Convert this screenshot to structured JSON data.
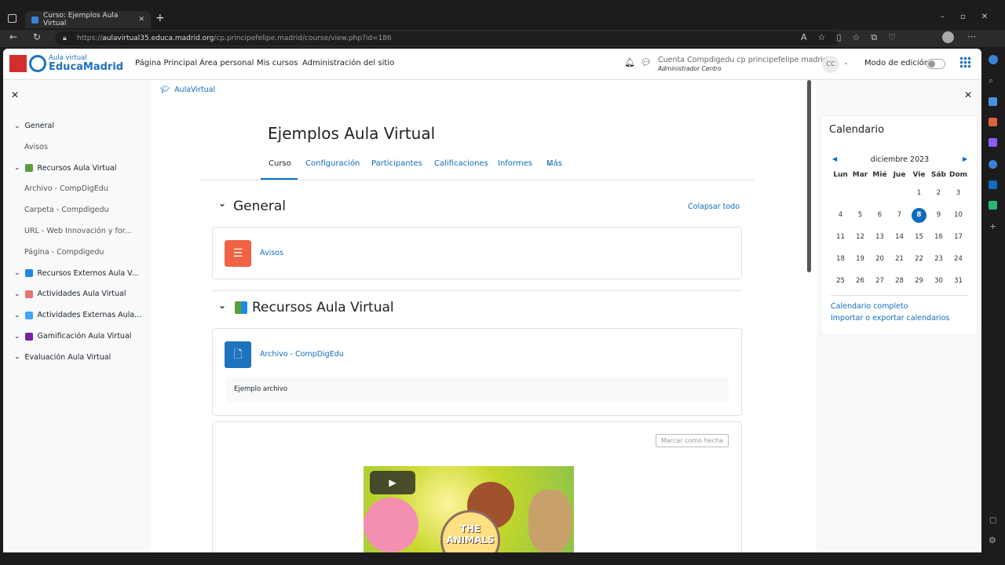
{
  "browser": {
    "tab_title": "Curso: Ejemplos Aula Virtual",
    "url_prefix": "https://",
    "url_domain": "aulavirtual35.educa.madrid.org",
    "url_path": "/cp.principefelipe.madrid/course/view.php?id=186"
  },
  "header": {
    "logo_small": "Aula virtual",
    "logo_big": "EducaMadrid",
    "nav": [
      "Página Principal",
      "Área personal",
      "Mis cursos",
      "Administración del sitio"
    ],
    "user_name": "Cuenta Compdigedu cp principefelipe madrid",
    "user_role": "Administrador Centro",
    "avatar": "CC",
    "edit_mode": "Modo de edición",
    "edit_mode_on": false
  },
  "sidebar": {
    "items": [
      {
        "label": "General",
        "level": 0,
        "icon": ""
      },
      {
        "label": "Avisos",
        "level": 1,
        "icon": ""
      },
      {
        "label": "Recursos Aula Virtual",
        "level": 0,
        "icon": "books-icon",
        "color": "#5a9e3a"
      },
      {
        "label": "Archivo - CompDigEdu",
        "level": 1,
        "icon": ""
      },
      {
        "label": "Carpeta - Compdigedu",
        "level": 1,
        "icon": ""
      },
      {
        "label": "URL - Web Innovación y for...",
        "level": 1,
        "icon": ""
      },
      {
        "label": "Página - Compdigedu",
        "level": 1,
        "icon": ""
      },
      {
        "label": "Recursos Externos Aula V...",
        "level": 0,
        "icon": "calendar-box-icon",
        "color": "#1e88e5"
      },
      {
        "label": "Actividades Aula Virtual",
        "level": 0,
        "icon": "pencil-paper-icon",
        "color": "#e57373"
      },
      {
        "label": "Actividades Externas Aula...",
        "level": 0,
        "icon": "book-icon",
        "color": "#42a5f5"
      },
      {
        "label": "Gamificación Aula Virtual",
        "level": 0,
        "icon": "gamepad-icon",
        "color": "#7b1fa2"
      },
      {
        "label": "Evaluación Aula Virtual",
        "level": 0,
        "icon": ""
      }
    ]
  },
  "breadcrumb": "AulaVirtual",
  "course": {
    "title": "Ejemplos Aula Virtual",
    "tabs": [
      "Curso",
      "Configuración",
      "Participantes",
      "Calificaciones",
      "Informes",
      "Más"
    ],
    "active_tab": 0,
    "collapse_all": "Colapsar todo"
  },
  "sections": [
    {
      "title": "General",
      "activities": [
        {
          "name": "Avisos",
          "icon": "forum-icon",
          "color": "#f06445"
        }
      ]
    },
    {
      "title": "Recursos Aula Virtual",
      "activities": [
        {
          "name": "Archivo - CompDigEdu",
          "icon": "file-icon",
          "color": "#1e73be",
          "description": "Ejemplo archivo"
        }
      ]
    }
  ],
  "video_card": {
    "mark_done": "Marcar como hecha",
    "thumb_title_1": "THE",
    "thumb_title_2": "ANIMALS"
  },
  "calendar": {
    "title": "Calendario",
    "month": "diciembre 2023",
    "days": [
      "Lun",
      "Mar",
      "Mié",
      "Jue",
      "Vie",
      "Sáb",
      "Dom"
    ],
    "weeks": [
      [
        "",
        "",
        "",
        "",
        "1",
        "2",
        "3"
      ],
      [
        "4",
        "5",
        "6",
        "7",
        "8",
        "9",
        "10"
      ],
      [
        "11",
        "12",
        "13",
        "14",
        "15",
        "16",
        "17"
      ],
      [
        "18",
        "19",
        "20",
        "21",
        "22",
        "23",
        "24"
      ],
      [
        "25",
        "26",
        "27",
        "28",
        "29",
        "30",
        "31"
      ]
    ],
    "today": "8",
    "full_link": "Calendario completo",
    "export_link": "Importar o exportar calendarios"
  }
}
